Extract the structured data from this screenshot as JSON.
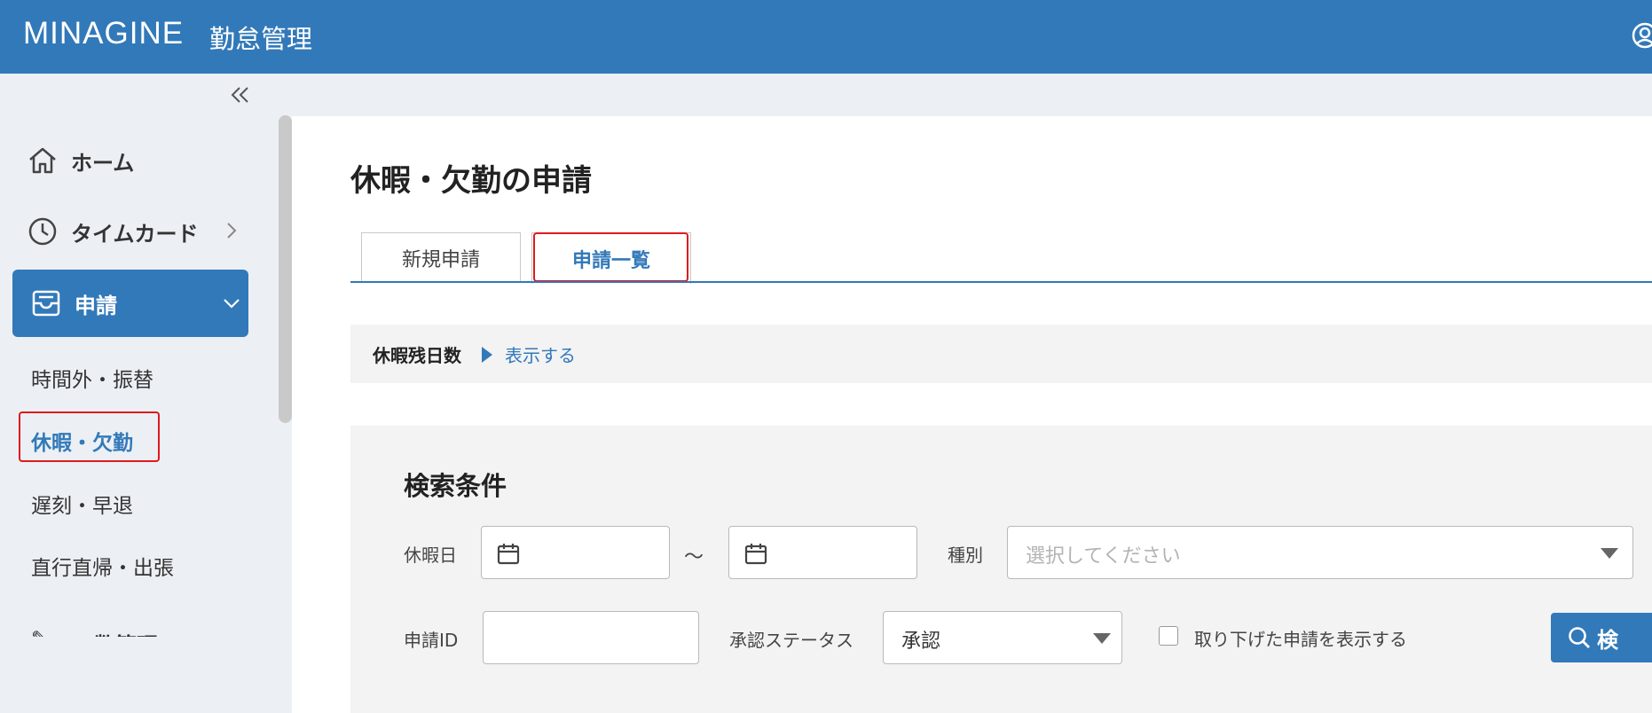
{
  "header": {
    "logo": "MINAGINE",
    "product": "勤怠管理"
  },
  "sidebar": {
    "items": [
      {
        "label": "ホーム",
        "icon": "home-icon"
      },
      {
        "label": "タイムカード",
        "icon": "clock-icon"
      },
      {
        "label": "申請",
        "icon": "inbox-icon"
      }
    ],
    "sub_items": [
      "時間外・振替",
      "休暇・欠勤",
      "遅刻・早退",
      "直行直帰・出張"
    ],
    "partial_item": "工数管理"
  },
  "main": {
    "title": "休暇・欠勤の申請",
    "tabs": [
      "新規申請",
      "申請一覧"
    ],
    "leave": {
      "label": "休暇残日数",
      "link": "表示する"
    },
    "search": {
      "title": "検索条件",
      "date_label": "休暇日",
      "range_sep": "～",
      "type_label": "種別",
      "type_placeholder": "選択してください",
      "id_label": "申請ID",
      "status_label": "承認ステータス",
      "status_value": "承認",
      "withdrawn_label": "取り下げた申請を表示する",
      "button": "検"
    }
  },
  "colors": {
    "primary": "#3279b9",
    "highlight": "#e0191e"
  }
}
